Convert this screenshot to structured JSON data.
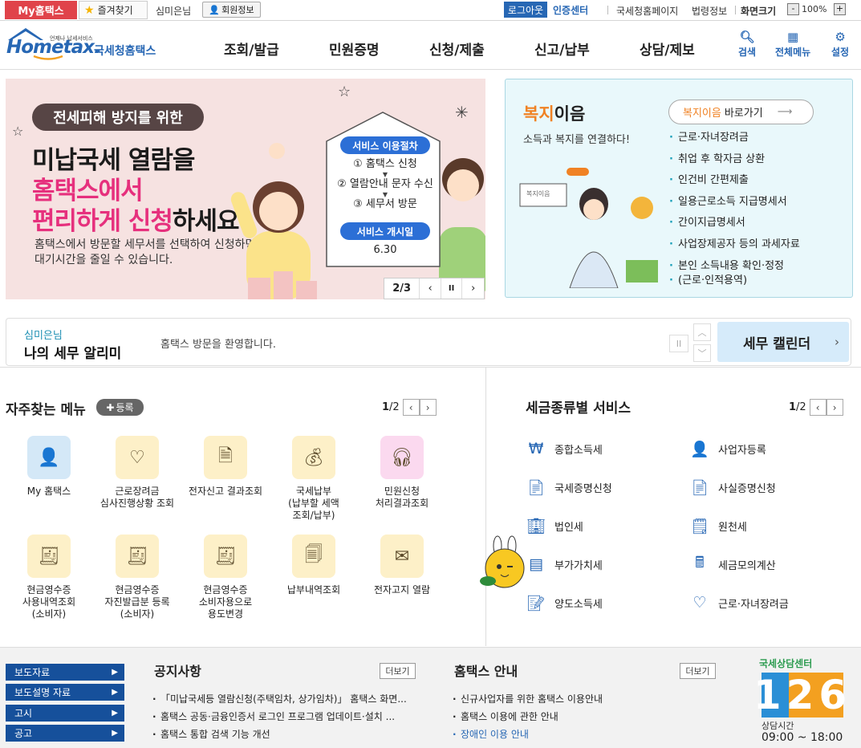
{
  "topbar": {
    "my_hometax": "My홈택스",
    "favorites": "즐겨찾기",
    "user_name": "심미은님",
    "member_info": "회원정보",
    "logout": "로그아웃",
    "cert_center": "인증센터",
    "links": [
      "국세청홈페이지",
      "법령정보"
    ],
    "zoom_label": "화면크기",
    "zoom_value": "100%",
    "zoom_minus": "-",
    "zoom_plus": "+"
  },
  "header": {
    "logo_small": "언제나 납세서비스",
    "logo_main": "Hometax.",
    "logo_kr": "국세청홈택스",
    "nav": [
      "조회/발급",
      "민원증명",
      "신청/제출",
      "신고/납부",
      "상담/제보"
    ],
    "icons": [
      {
        "label": "검색",
        "icon": "search-icon"
      },
      {
        "label": "전체메뉴",
        "icon": "grid-menu-icon"
      },
      {
        "label": "설정",
        "icon": "gear-icon"
      }
    ]
  },
  "banner": {
    "pill": "전세피해 방지를 위한",
    "line1": "미납국세 열람을",
    "line2": "홈택스에서",
    "line3_pink": "편리하게 신청",
    "line3_rest": "하세요!",
    "sub1": "홈택스에서 방문할 세무서를 선택하여 신청하면",
    "sub2": "대기시간을 줄일 수 있습니다.",
    "proc_tag": "서비스 이용절차",
    "steps": [
      "① 홈택스 신청",
      "② 열람안내 문자 수신",
      "③ 세무서 방문"
    ],
    "start_tag": "서비스 개시일",
    "start_date": "6.30",
    "page": "2/3",
    "prev": "‹",
    "pause": "II",
    "next": "›"
  },
  "welfare": {
    "title_o": "복지",
    "title_rest": "이음",
    "sub": "소득과 복지를 연결하다!",
    "btn_o": "복지이음",
    "btn_rest": "바로가기",
    "items": [
      "근로·자녀장려금",
      "취업 후 학자금 상환",
      "인건비 간편제출",
      "일용근로소득 지급명세서",
      "간이지급명세서",
      "사업장제공자 등의 과세자료",
      "본인 소득내용 확인·정정",
      "(근로·인적용역)"
    ],
    "sign_text": "복지이음"
  },
  "alert": {
    "name": "심미은님",
    "title": "나의 세무 알리미",
    "message": "홈택스 방문을 환영합니다.",
    "pause": "II",
    "up": "︿",
    "down": "﹀",
    "calendar": "세무 캘린더",
    "calendar_arrow": "›"
  },
  "freq_menu": {
    "title": "자주찾는 메뉴",
    "register": "등록",
    "page_cur": "1",
    "page_total": "/2",
    "items": [
      {
        "label": "My 홈택스",
        "icon": "person-icon",
        "bg": "#d4e8f7"
      },
      {
        "label": "근로장려금\n심사진행상황 조회",
        "icon": "heart-hourglass-icon",
        "bg": "#fdf0c8"
      },
      {
        "label": "전자신고 결과조회",
        "icon": "document-search-icon",
        "bg": "#fdf0c8"
      },
      {
        "label": "국세납부\n(납부할 세액\n조회/납부)",
        "icon": "money-bag-icon",
        "bg": "#fdf0c8"
      },
      {
        "label": "민원신청\n처리결과조회",
        "icon": "headset-icon",
        "bg": "#fbd9ef"
      },
      {
        "label": "현금영수증\n사용내역조회\n(소비자)",
        "icon": "receipt-search-icon",
        "bg": "#fdf0c8"
      },
      {
        "label": "현금영수증\n자진발급분 등록\n(소비자)",
        "icon": "receipt-search-icon",
        "bg": "#fdf0c8"
      },
      {
        "label": "현금영수증\n소비자용으로\n용도변경",
        "icon": "receipt-search-icon",
        "bg": "#fdf0c8"
      },
      {
        "label": "납부내역조회",
        "icon": "payment-search-icon",
        "bg": "#fdf0c8"
      },
      {
        "label": "전자고지 열람",
        "icon": "envelope-icon",
        "bg": "#fdf0c8"
      }
    ]
  },
  "tax_services": {
    "title": "세금종류별 서비스",
    "page_cur": "1",
    "page_total": "/2",
    "items": [
      {
        "label": "종합소득세",
        "icon": "money-pouch-icon"
      },
      {
        "label": "사업자등록",
        "icon": "person-icon"
      },
      {
        "label": "국세증명신청",
        "icon": "document-icon"
      },
      {
        "label": "사실증명신청",
        "icon": "document-icon"
      },
      {
        "label": "법인세",
        "icon": "building-icon"
      },
      {
        "label": "원천세",
        "icon": "salary-doc-icon"
      },
      {
        "label": "부가가치세",
        "icon": "vat-icon"
      },
      {
        "label": "세금모의계산",
        "icon": "calculator-icon"
      },
      {
        "label": "양도소득세",
        "icon": "transfer-doc-icon"
      },
      {
        "label": "근로·자녀장려금",
        "icon": "heart-icon"
      }
    ]
  },
  "footer": {
    "side_buttons": [
      "보도자료",
      "보도설명 자료",
      "고시",
      "공고"
    ],
    "notice_title": "공지사항",
    "notice_more": "더보기",
    "notices": [
      "「미납국세등 열람신청(주택임차, 상가임차)」 홈택스 화면...",
      "홈택스 공동·금융인증서 로그인 프로그램 업데이트·설치 ...",
      "홈택스 통합 검색 기능 개선"
    ],
    "guide_title": "홈택스 안내",
    "guide_more": "더보기",
    "guides": [
      "신규사업자를 위한 홈택스 이용안내",
      "홈택스 이용에 관한 안내",
      "장애인 이용 안내"
    ],
    "cc_label": "국세상담센터",
    "cc_number": "126",
    "cc_hours_label": "상담시간",
    "cc_hours": "09:00 ~ 18:00"
  }
}
